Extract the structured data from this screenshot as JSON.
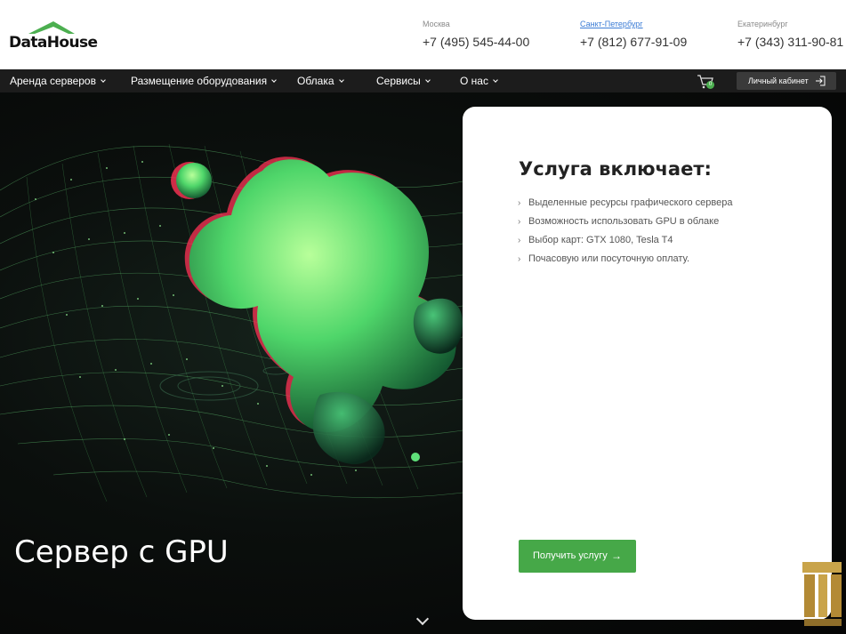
{
  "header": {
    "logo_text": "DataHouse",
    "contacts": [
      {
        "city": "Москва",
        "phone": "+7 (495) 545-44-00"
      },
      {
        "city": "Санкт-Петербург",
        "phone": "+7 (812) 677-91-09"
      },
      {
        "city": "Екатеринбург",
        "phone": "+7 (343) 311-90-81"
      }
    ]
  },
  "nav": {
    "items": [
      {
        "label": "Аренда серверов"
      },
      {
        "label": "Размещение оборудования"
      },
      {
        "label": "Облака"
      },
      {
        "label": "Сервисы"
      },
      {
        "label": "О нас"
      }
    ],
    "cart_count": "0",
    "cabinet_label": "Личный кабинет"
  },
  "hero": {
    "title": "Сервер с GPU"
  },
  "card": {
    "title": "Услуга включает:",
    "features": [
      "Выделенные ресурсы графического сервера",
      "Возможность использовать GPU в облаке",
      "Выбор карт: GTX 1080, Tesla T4",
      "Почасовую или посуточную оплату."
    ],
    "cta_label": "Получить услугу"
  },
  "colors": {
    "accent": "#46a848",
    "nav_bg": "#1c1c1c",
    "link": "#3a7bd5"
  },
  "icons": [
    "chevron-down-icon",
    "cart-icon",
    "login-icon",
    "arrow-right-icon",
    "house-roof-icon"
  ]
}
